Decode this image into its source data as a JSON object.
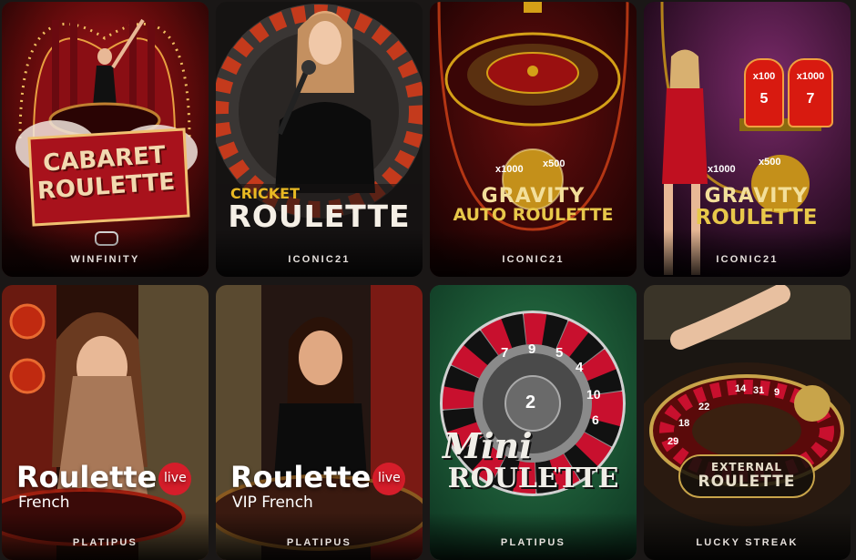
{
  "cards": [
    {
      "title_line1": "CABARET",
      "title_line2": "ROULETTE",
      "provider": "WINFINITY",
      "colors": {
        "bg": "#5a0a0a",
        "accent": "#c8102e",
        "title": "#f2d9b0"
      }
    },
    {
      "title_line1": "CRICKET",
      "title_line2": "ROULETTE",
      "provider": "ICONIC21",
      "colors": {
        "bg": "#1d1a18",
        "accent": "#e8b923",
        "title": "#f5efe6"
      }
    },
    {
      "title_line1": "GRAVITY",
      "title_line2": "AUTO ROULETTE",
      "provider": "ICONIC21",
      "multipliers": [
        "x1000",
        "x500"
      ],
      "colors": {
        "bg": "#3a0606",
        "accent": "#d4a017",
        "title": "#f3df9a"
      }
    },
    {
      "title_line1": "GRAVITY",
      "title_line2": "ROULETTE",
      "provider": "ICONIC21",
      "multipliers": [
        "x1000",
        "x500"
      ],
      "badges": [
        {
          "mult": "x100",
          "num": "5"
        },
        {
          "mult": "x1000",
          "num": "7"
        }
      ],
      "colors": {
        "bg": "#2a0a2a",
        "accent": "#d4a017",
        "title": "#f3df9a"
      }
    },
    {
      "title": "Roulette",
      "live": "live",
      "subtitle": "French",
      "provider": "PLATIPUS",
      "colors": {
        "bg": "#3a1410",
        "accent": "#d51d2a",
        "title": "#ffffff"
      }
    },
    {
      "title": "Roulette",
      "live": "live",
      "subtitle": "VIP French",
      "provider": "PLATIPUS",
      "colors": {
        "bg": "#2b1a14",
        "accent": "#d51d2a",
        "title": "#ffffff"
      }
    },
    {
      "title_line1": "Mini",
      "title_line2": "ROULETTE",
      "provider": "PLATIPUS",
      "wheel_numbers": [
        "7",
        "9",
        "5",
        "4",
        "10",
        "6"
      ],
      "center_number": "2",
      "colors": {
        "bg": "#1f5a3a",
        "accent": "#c8102e",
        "title": "#f0eee8"
      }
    },
    {
      "title_line1": "EXTERNAL",
      "title_line2": "ROULETTE",
      "provider": "LUCKY STREAK",
      "wheel_numbers": [
        "14",
        "31",
        "9",
        "22",
        "18",
        "29"
      ],
      "colors": {
        "bg": "#1a1612",
        "accent": "#c8a44a",
        "title": "#e8e0cc"
      }
    }
  ]
}
